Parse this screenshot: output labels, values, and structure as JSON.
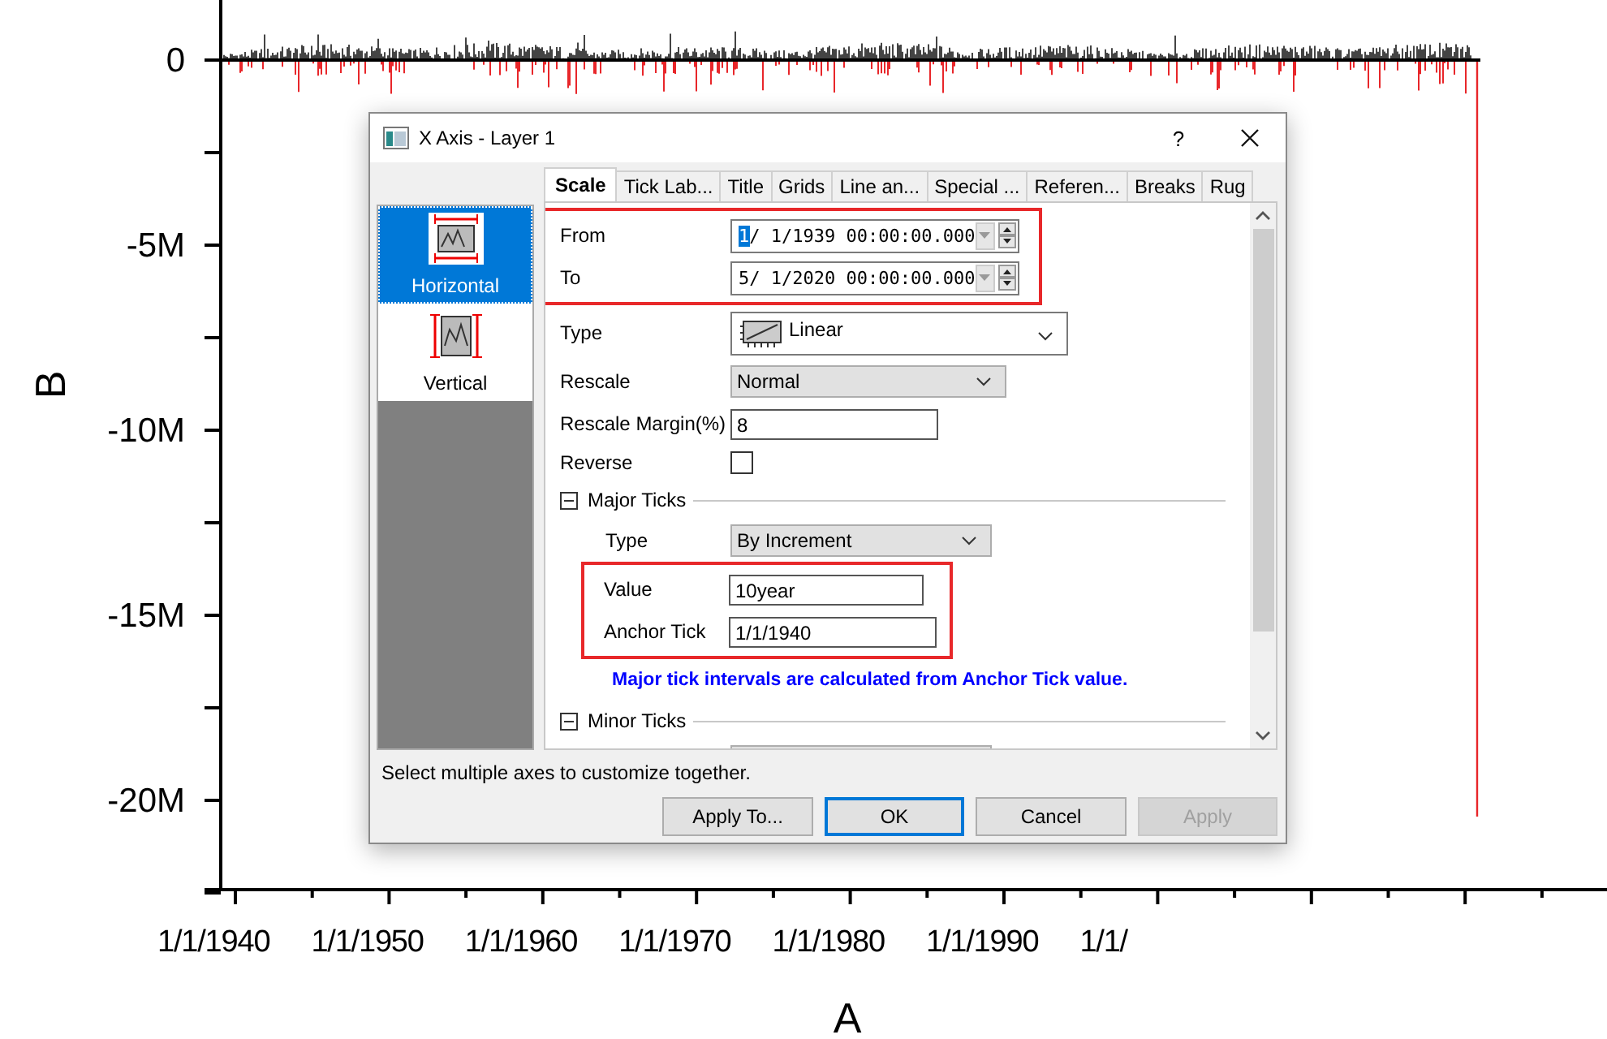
{
  "plot": {
    "y_title": "B",
    "x_title": "A",
    "y_ticks": [
      "0",
      "-5M",
      "-10M",
      "-15M",
      "-20M"
    ],
    "x_ticks": [
      "1/1/1940",
      "1/1/1950",
      "1/1/1960",
      "1/1/1970",
      "1/1/1980",
      "1/1/1990",
      "1/1/"
    ]
  },
  "dialog": {
    "title": "X Axis - Layer 1",
    "help": "?",
    "tabs": [
      {
        "label": "Scale",
        "selected": true
      },
      {
        "label": "Tick Lab...",
        "selected": false
      },
      {
        "label": "Title",
        "selected": false
      },
      {
        "label": "Grids",
        "selected": false
      },
      {
        "label": "Line an...",
        "selected": false
      },
      {
        "label": "Special ...",
        "selected": false
      },
      {
        "label": "Referen...",
        "selected": false
      },
      {
        "label": "Breaks",
        "selected": false
      },
      {
        "label": "Rug",
        "selected": false
      }
    ],
    "axes": [
      {
        "label": "Horizontal",
        "selected": true
      },
      {
        "label": "Vertical",
        "selected": false
      }
    ],
    "fields": [
      {
        "kind": "group",
        "highlighted": true,
        "children": [
          {
            "kind": "datetime",
            "label": "From",
            "selected_text": "1",
            "value": "/ 1/1939 00:00:00.000"
          },
          {
            "kind": "datetime",
            "label": "To",
            "value": "5/ 1/2020 00:00:00.000"
          }
        ]
      },
      {
        "kind": "icon_combo",
        "label": "Type",
        "value": "Linear"
      },
      {
        "kind": "combo",
        "label": "Rescale",
        "value": "Normal"
      },
      {
        "kind": "text",
        "label": "Rescale Margin(%)",
        "value": "8"
      },
      {
        "kind": "checkbox",
        "label": "Reverse",
        "checked": false
      },
      {
        "kind": "section",
        "label": "Major Ticks",
        "expanded": true,
        "children": [
          {
            "kind": "combo",
            "label": "Type",
            "value": "By Increment"
          },
          {
            "kind": "group",
            "highlighted": true,
            "children": [
              {
                "kind": "text",
                "label": "Value",
                "value": "10year"
              },
              {
                "kind": "text",
                "label": "Anchor Tick",
                "value": "1/1/1940"
              }
            ]
          },
          {
            "kind": "note",
            "text": "Major tick intervals are calculated from Anchor Tick value."
          }
        ]
      },
      {
        "kind": "section",
        "label": "Minor Ticks",
        "expanded": true,
        "children": [
          {
            "kind": "combo"
          }
        ]
      }
    ],
    "status": "Select multiple axes to customize together.",
    "buttons": [
      {
        "label": "Apply To...",
        "default": false,
        "disabled": false
      },
      {
        "label": "OK",
        "default": true,
        "disabled": false
      },
      {
        "label": "Cancel",
        "default": false,
        "disabled": false
      },
      {
        "label": "Apply",
        "default": false,
        "disabled": true
      }
    ]
  }
}
